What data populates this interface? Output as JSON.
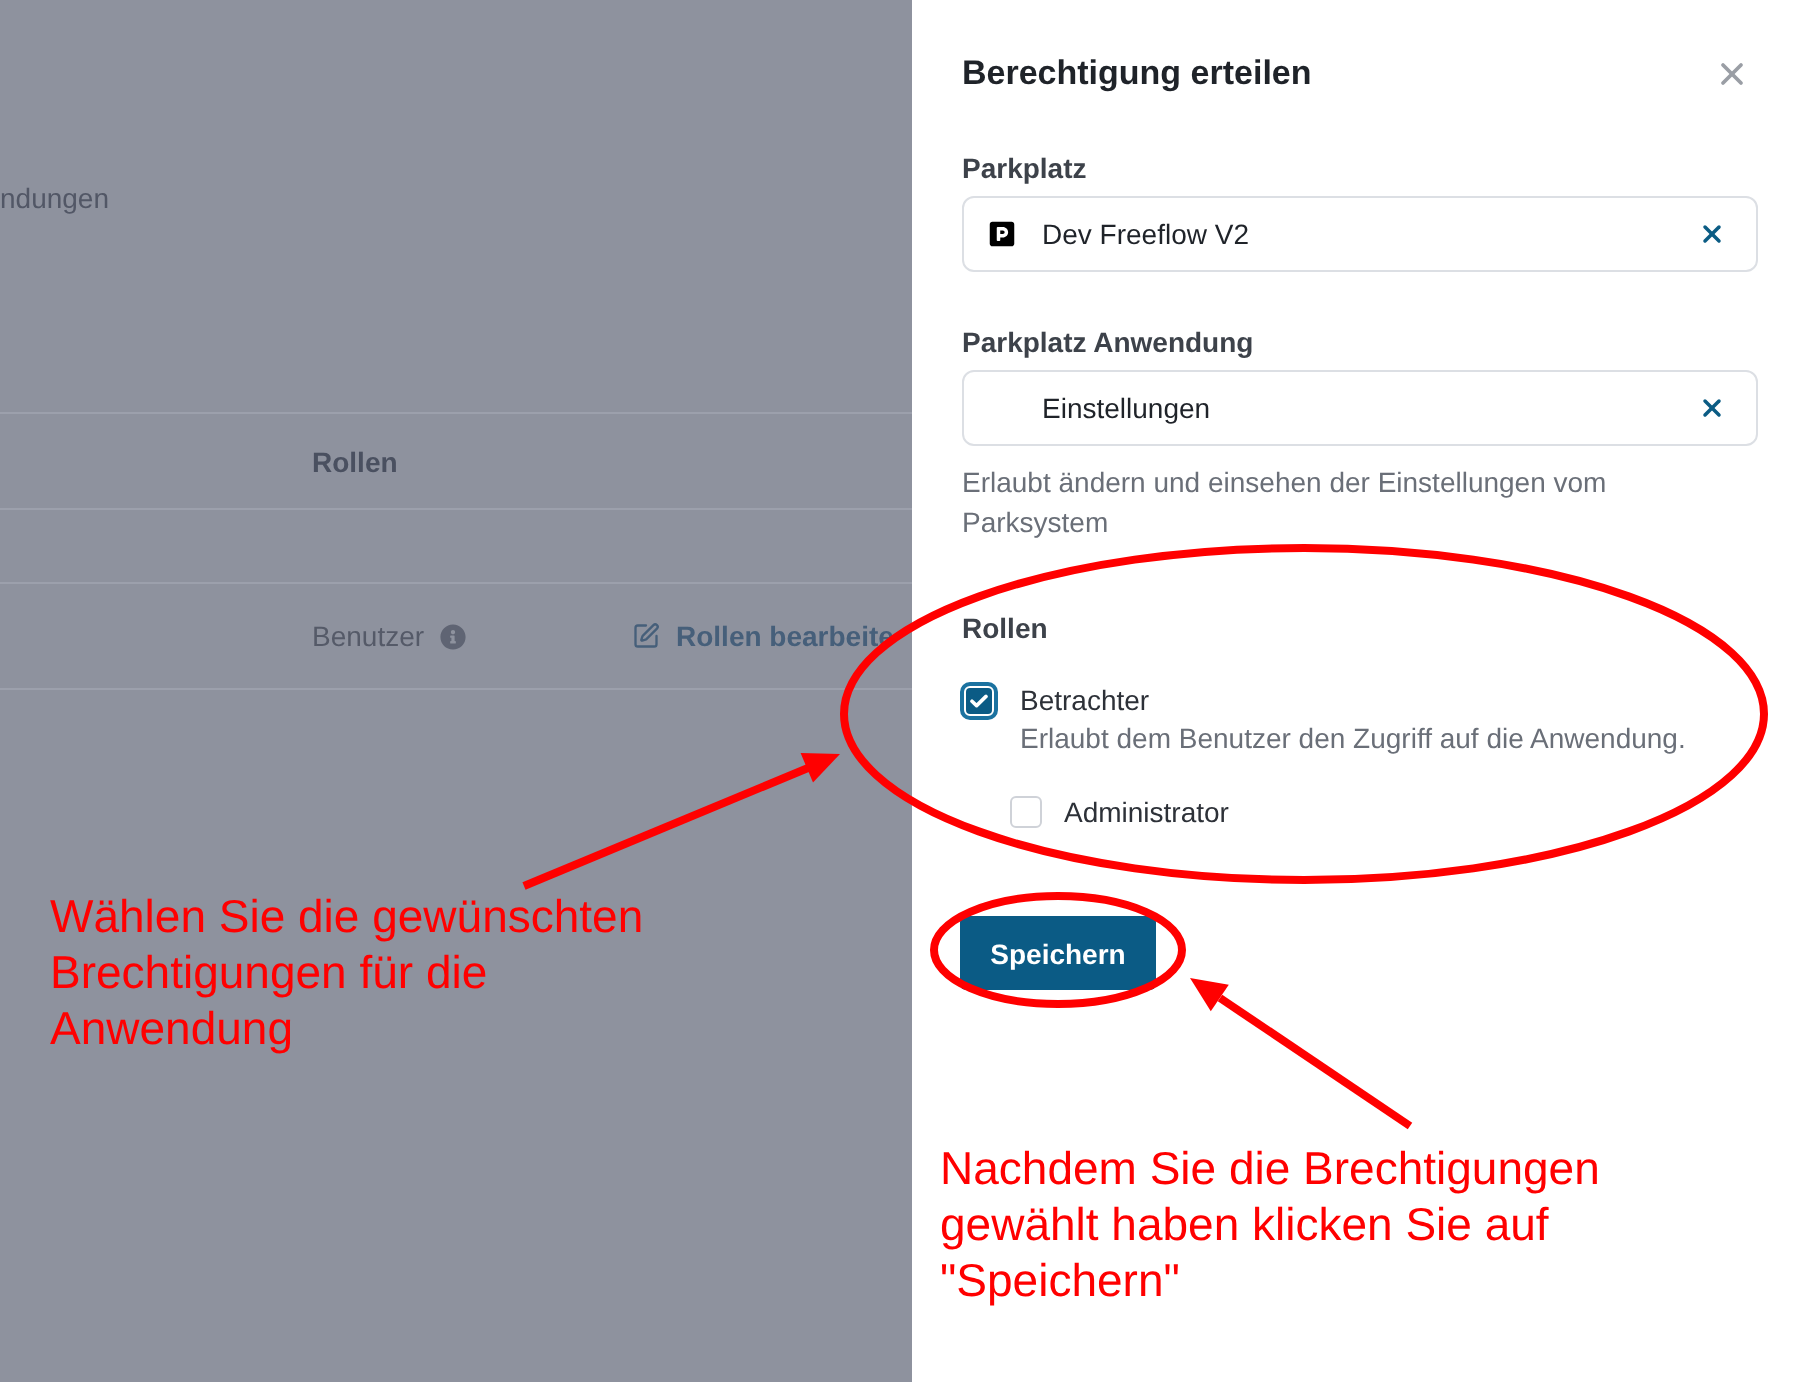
{
  "backdrop": {
    "heading": "ndungen",
    "table": {
      "columns": [
        "Rollen"
      ],
      "rows": [
        {
          "role": "Benutzer",
          "action": "Rollen bearbeite"
        }
      ]
    }
  },
  "dialog": {
    "title": "Berechtigung erteilen",
    "fields": [
      {
        "label": "Parkplatz",
        "value": "Dev Freeflow V2",
        "kind": "parking"
      },
      {
        "label": "Parkplatz Anwendung",
        "value": "Einstellungen",
        "kind": "plain"
      }
    ],
    "help": "Erlaubt ändern und einsehen der Einstellungen vom Parksystem",
    "roles_label": "Rollen",
    "roles": [
      {
        "name": "Betrachter",
        "description": "Erlaubt dem Benutzer den Zugriff auf die Anwendung.",
        "checked": true,
        "focused": true,
        "children": [
          {
            "name": "Administrator",
            "checked": false,
            "focused": false
          }
        ]
      }
    ],
    "save_button": "Speichern"
  },
  "annotations": [
    {
      "text": "Wählen Sie die gewünschten Brechtigungen für die Anwendung"
    },
    {
      "text": "Nachdem Sie die Brechtigungen gewählt haben klicken Sie auf \"Speichern\""
    }
  ]
}
